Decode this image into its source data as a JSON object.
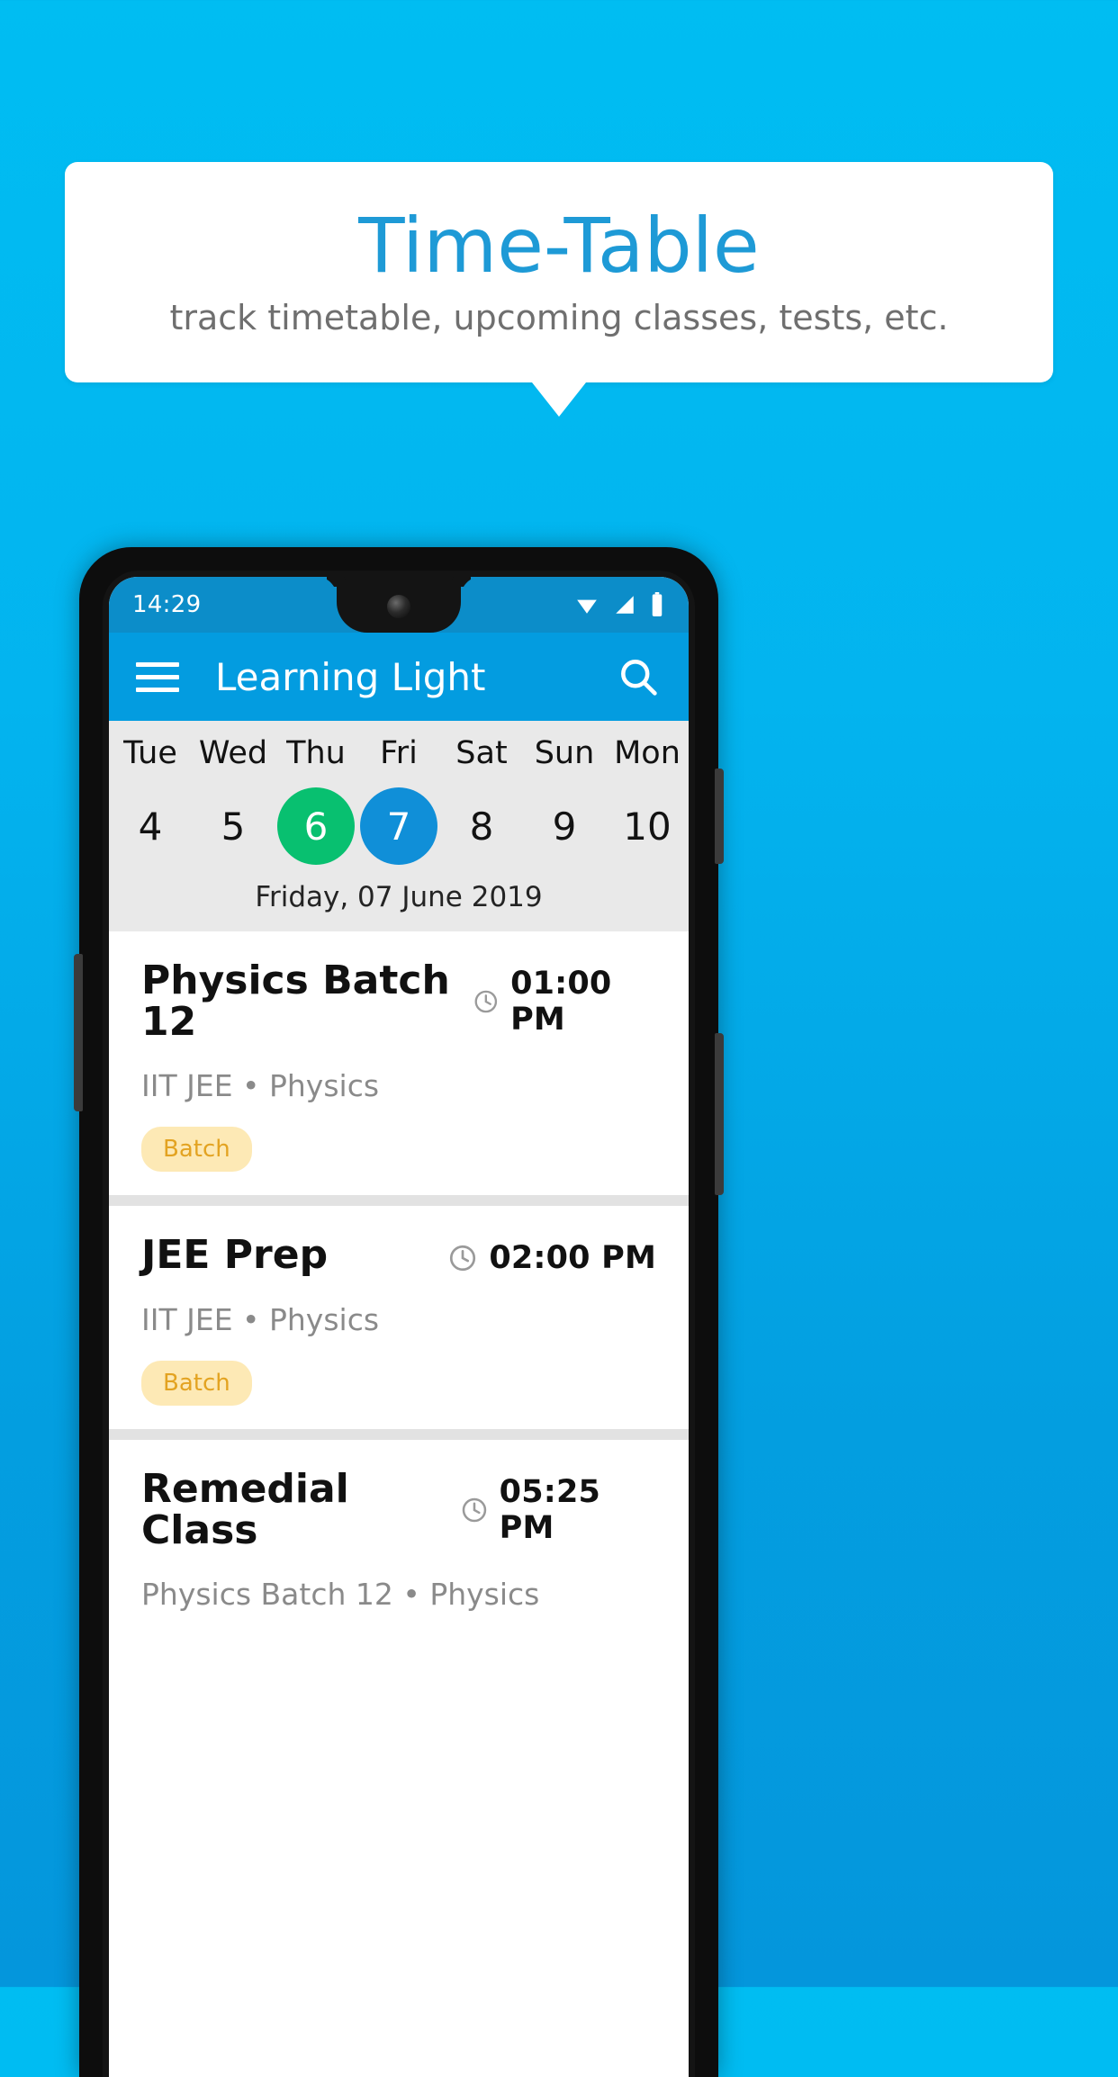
{
  "header": {
    "title": "Time-Table",
    "subtitle": "track timetable, upcoming classes, tests, etc.",
    "title_color": "#1e9ad6",
    "subtitle_color": "#6f6f6f"
  },
  "background": {
    "gradient_top": "#00bdf2",
    "gradient_bottom": "#0496dc"
  },
  "phone": {
    "status_bar": {
      "time": "14:29",
      "icons": [
        "wifi-icon",
        "signal-icon",
        "battery-icon"
      ],
      "background": "#0c8dc9"
    },
    "app_bar": {
      "menu_icon": "hamburger-menu-icon",
      "title": "Learning Light",
      "search_icon": "search-icon",
      "background": "#039ce0"
    },
    "date_strip": {
      "background": "#e9e9e9",
      "days": [
        {
          "name": "Tue",
          "num": "4",
          "state": "normal"
        },
        {
          "name": "Wed",
          "num": "5",
          "state": "normal"
        },
        {
          "name": "Thu",
          "num": "6",
          "state": "today"
        },
        {
          "name": "Fri",
          "num": "7",
          "state": "selected"
        },
        {
          "name": "Sat",
          "num": "8",
          "state": "normal"
        },
        {
          "name": "Sun",
          "num": "9",
          "state": "normal"
        },
        {
          "name": "Mon",
          "num": "10",
          "state": "normal"
        }
      ],
      "today_color": "#08c070",
      "selected_color": "#108fd8",
      "selected_date_label": "Friday, 07 June 2019"
    },
    "events": [
      {
        "title": "Physics Batch 12",
        "time": "01:00 PM",
        "clock_icon": "clock-icon",
        "subtitle": "IIT JEE • Physics",
        "badge": "Batch",
        "badge_bg": "#fde9b5",
        "badge_color": "#e3a321"
      },
      {
        "title": "JEE Prep",
        "time": "02:00 PM",
        "clock_icon": "clock-icon",
        "subtitle": "IIT JEE • Physics",
        "badge": "Batch",
        "badge_bg": "#fde9b5",
        "badge_color": "#e3a321"
      },
      {
        "title": "Remedial Class",
        "time": "05:25 PM",
        "clock_icon": "clock-icon",
        "subtitle": "Physics Batch 12 • Physics",
        "badge": "",
        "badge_bg": "#fde9b5",
        "badge_color": "#e3a321"
      }
    ]
  }
}
